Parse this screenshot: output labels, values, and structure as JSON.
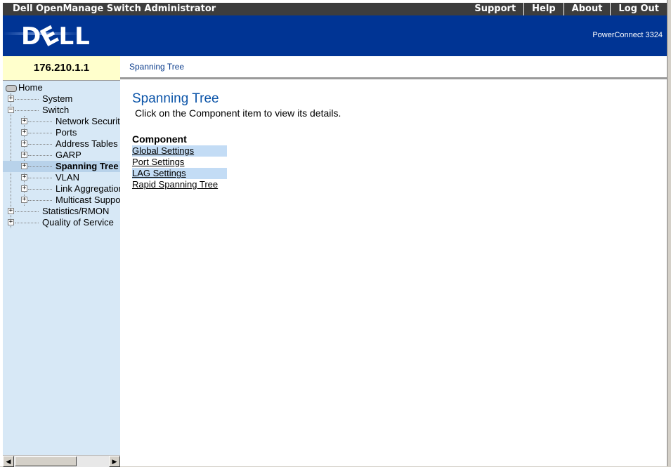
{
  "topbar": {
    "title": "Dell OpenManage Switch Administrator",
    "nav": [
      "Support",
      "Help",
      "About",
      "Log Out"
    ]
  },
  "banner": {
    "logo_d": "D",
    "logo_e": "E",
    "logo_ll": "LL",
    "model": "PowerConnect 3324"
  },
  "device": {
    "ip": "176.210.1.1"
  },
  "breadcrumb": {
    "current": "Spanning Tree"
  },
  "tree": {
    "home": "Home",
    "system": "System",
    "switch": "Switch",
    "network_security": "Network Securit",
    "ports": "Ports",
    "address_tables": "Address Tables",
    "garp": "GARP",
    "spanning_tree": "Spanning Tree",
    "vlan": "VLAN",
    "link_aggregation": "Link Aggregation",
    "multicast_support": "Multicast Suppo",
    "statistics_rmon": "Statistics/RMON",
    "quality_of_service": "Quality of Service",
    "expand_glyph": "+",
    "collapse_glyph": "−"
  },
  "content": {
    "title": "Spanning Tree",
    "description": "Click on the Component item to view its details.",
    "component_heading": "Component",
    "links": [
      "Global Settings",
      "Port Settings",
      "LAG Settings",
      "Rapid Spanning Tree"
    ]
  },
  "scrollbar": {
    "left_arrow": "◀",
    "right_arrow": "▶"
  },
  "colors": {
    "banner_blue": "#003494",
    "title_blue": "#0b54a8",
    "sidebar_bg": "#d7e8f6",
    "ip_bg": "#ffffcc",
    "selected_bg": "#b8d2ea",
    "link_highlight": "#c3dcf5"
  }
}
